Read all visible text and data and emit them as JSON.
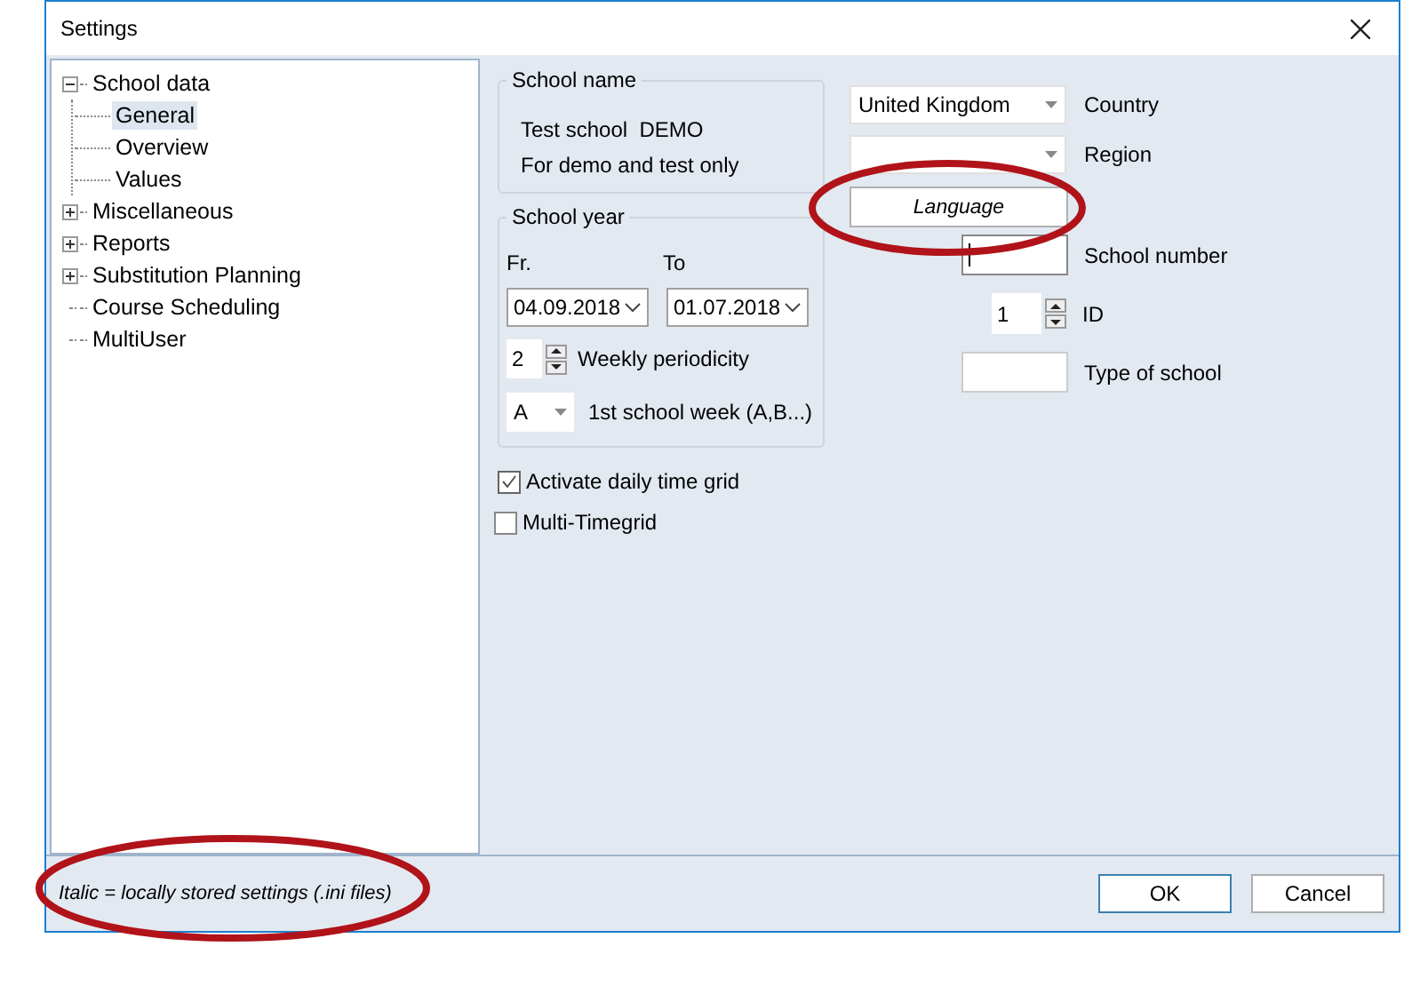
{
  "window": {
    "title": "Settings"
  },
  "tree": [
    {
      "label": "School data",
      "expanded": true,
      "selected": false,
      "children": [
        {
          "label": "General",
          "selected": true
        },
        {
          "label": "Overview",
          "selected": false
        },
        {
          "label": "Values",
          "selected": false
        }
      ]
    },
    {
      "label": "Miscellaneous",
      "expanded": false,
      "selected": false
    },
    {
      "label": "Reports",
      "expanded": false,
      "selected": false
    },
    {
      "label": "Substitution Planning",
      "expanded": false,
      "selected": false
    },
    {
      "label": "Course Scheduling",
      "selected": false
    },
    {
      "label": "MultiUser",
      "selected": false
    }
  ],
  "school_name": {
    "legend": "School name",
    "lines": [
      "Test school  DEMO",
      "For demo and test only"
    ]
  },
  "school_year": {
    "legend": "School year",
    "from_label": "Fr.",
    "to_label": "To",
    "from_value": "04.09.2018",
    "to_value": "01.07.2018",
    "periodicity": {
      "value": "2",
      "label": "Weekly periodicity"
    },
    "first_week": {
      "value": "A",
      "label": "1st school week (A,B...)"
    }
  },
  "checkboxes": [
    {
      "label": "Activate daily time grid",
      "checked": true
    },
    {
      "label": "Multi-Timegrid",
      "checked": false
    }
  ],
  "country": {
    "value": "United Kingdom",
    "label": "Country"
  },
  "region": {
    "label": "Region"
  },
  "language_button": "Language",
  "school_number": {
    "label": "School number"
  },
  "id": {
    "value": "1",
    "label": "ID"
  },
  "type_of_school": {
    "label": "Type of school"
  },
  "footer_note": "Italic = locally stored settings (.ini files)",
  "buttons": [
    {
      "label": "OK",
      "default": true
    },
    {
      "label": "Cancel",
      "default": false
    }
  ]
}
